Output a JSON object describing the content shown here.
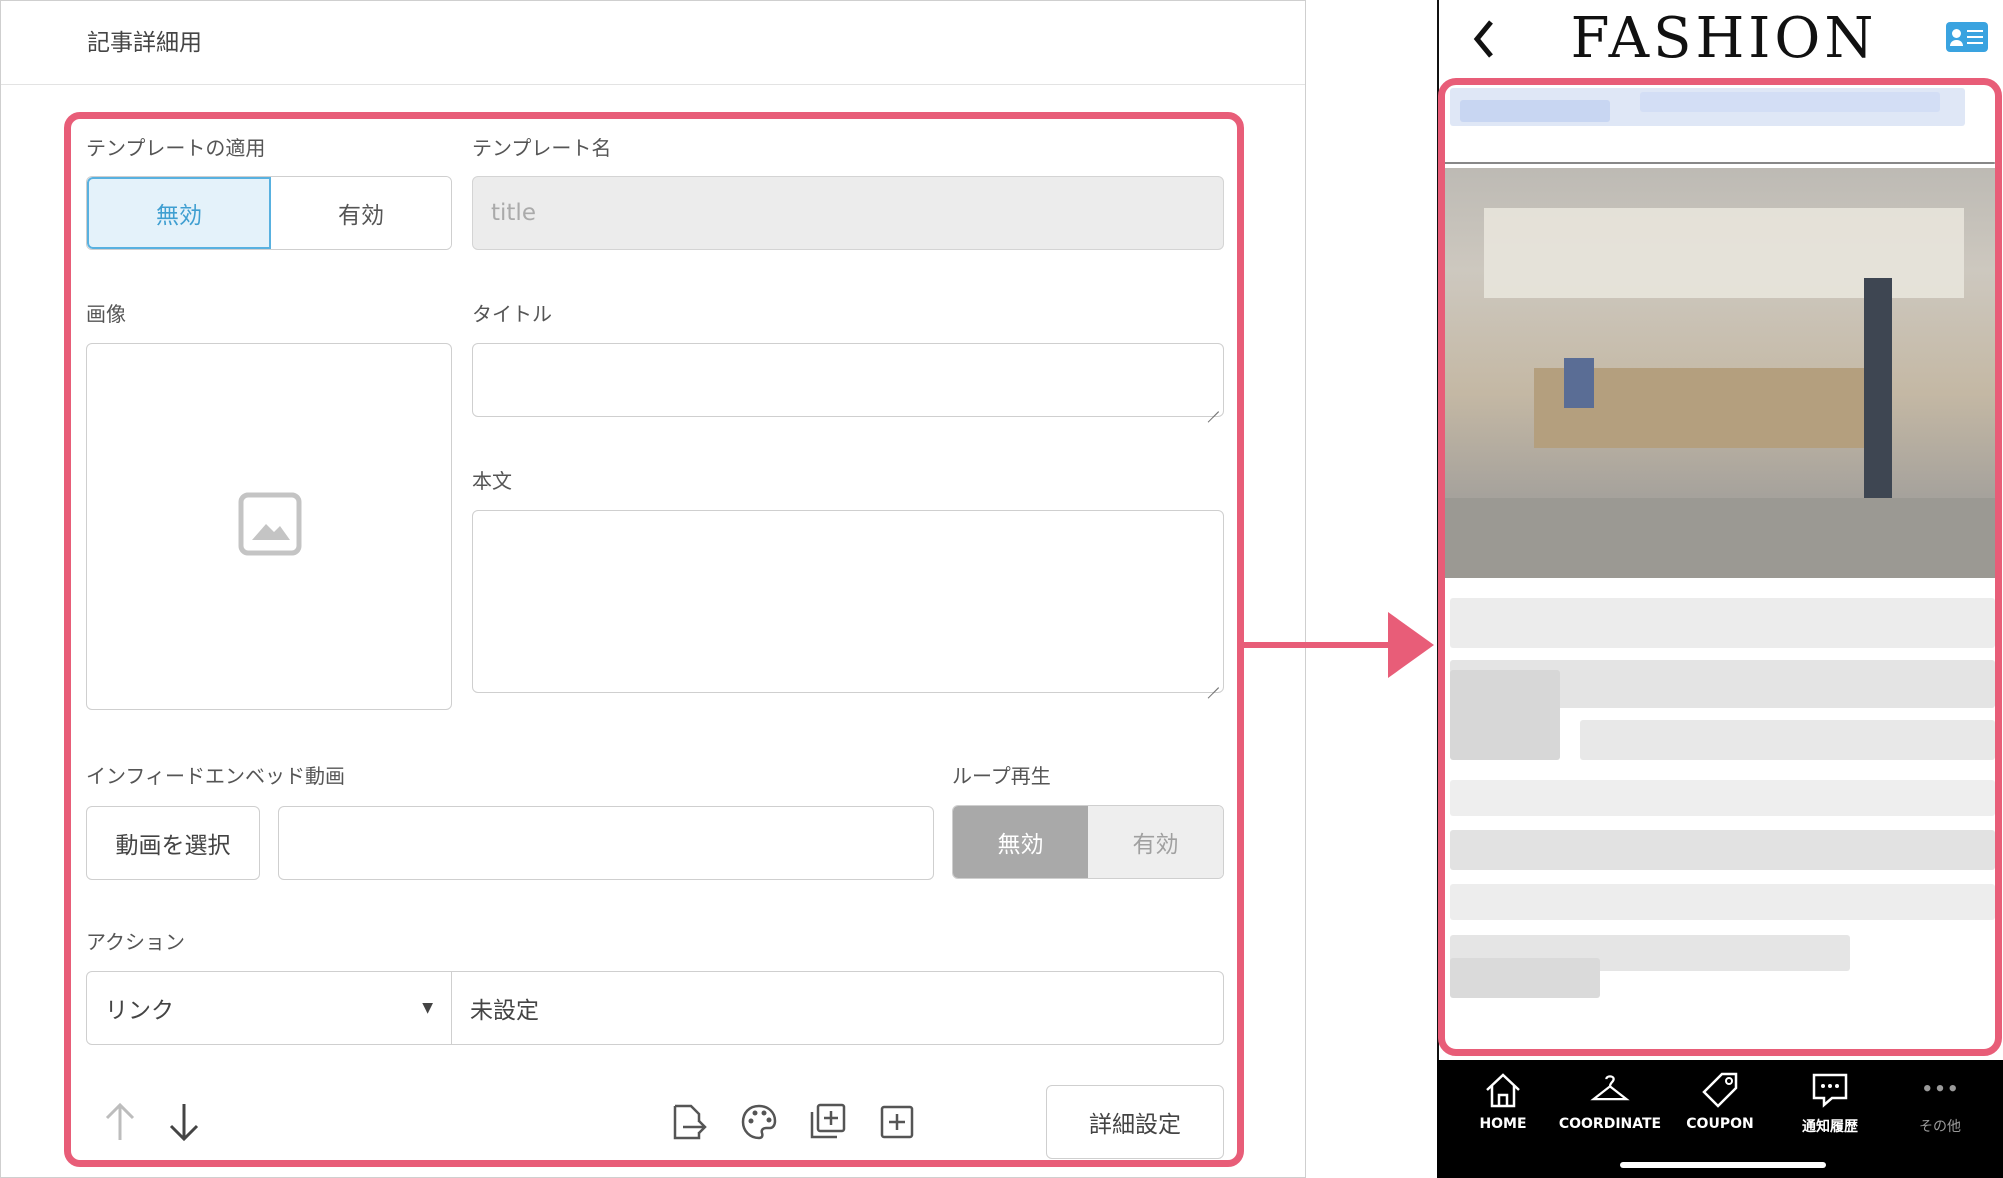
{
  "editor": {
    "title": "記事詳細用",
    "template_apply": {
      "label": "テンプレートの適用",
      "options": [
        "無効",
        "有効"
      ],
      "selected": "無効"
    },
    "template_name": {
      "label": "テンプレート名",
      "placeholder": "title"
    },
    "image": {
      "label": "画像",
      "icon": "image-placeholder-icon"
    },
    "title_field": {
      "label": "タイトル",
      "value": ""
    },
    "body_field": {
      "label": "本文",
      "value": ""
    },
    "video": {
      "label": "インフィードエンベッド動画",
      "select_button": "動画を選択",
      "value": ""
    },
    "loop": {
      "label": "ループ再生",
      "options": [
        "無効",
        "有効"
      ],
      "selected": "無効"
    },
    "action": {
      "label": "アクション",
      "type": "リンク",
      "value": "未設定"
    },
    "toolbar": {
      "icons": [
        "arrow-up-icon",
        "arrow-down-icon",
        "export-icon",
        "palette-icon",
        "duplicate-icon",
        "add-icon"
      ],
      "detail_button": "詳細設定"
    }
  },
  "phone": {
    "brand": "FASHION",
    "back_icon": "chevron-left-icon",
    "header_icon": "member-card-icon",
    "tabs": [
      {
        "label": "HOME",
        "icon": "home-icon"
      },
      {
        "label": "COORDINATE",
        "icon": "hanger-icon"
      },
      {
        "label": "COUPON",
        "icon": "tag-icon"
      },
      {
        "label": "通知履歴",
        "icon": "message-icon"
      },
      {
        "label": "その他",
        "icon": "more-icon"
      }
    ]
  },
  "colors": {
    "highlight": "#e85d78",
    "active_blue": "#3f9fd1",
    "active_gray": "#a9a9a9",
    "header_icon": "#3aa3e0"
  }
}
